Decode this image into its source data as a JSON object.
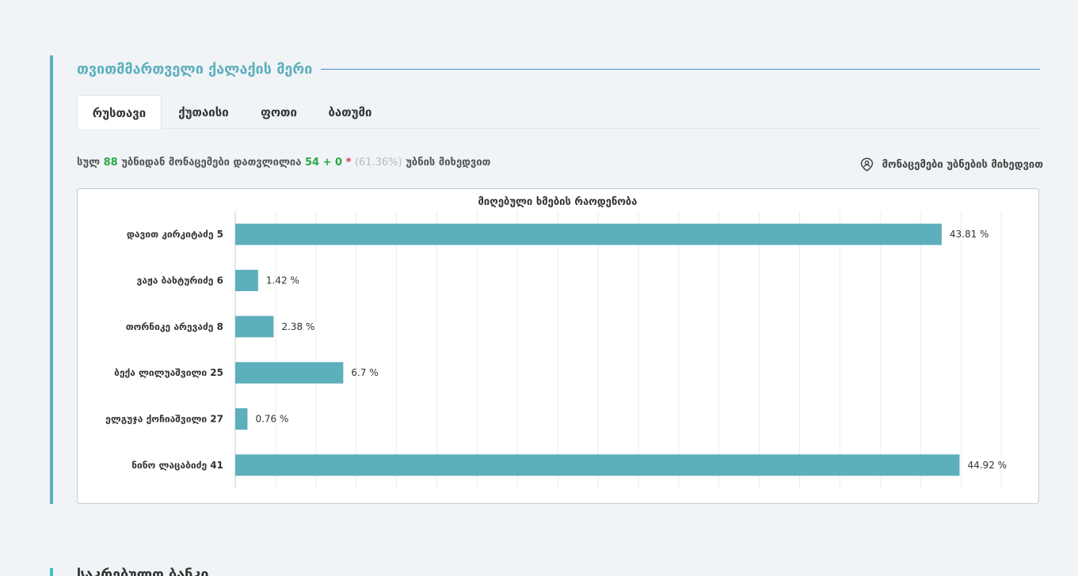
{
  "section": {
    "title": "თვითმმართველი ქალაქის მერი"
  },
  "tabs": [
    {
      "label": "რუსთავი",
      "active": true
    },
    {
      "label": "ქუთაისი",
      "active": false
    },
    {
      "label": "ფოთი",
      "active": false
    },
    {
      "label": "ბათუმი",
      "active": false
    }
  ],
  "stats": {
    "prefix": "სულ",
    "total_precincts": "88",
    "middle": "უბნიდან მონაცემები დათვლილია",
    "counted": "54 + 0",
    "star": "*",
    "percent": "(61.36%)",
    "suffix": "უბნის მიხედვით"
  },
  "by_precinct": {
    "label": "მონაცემები უბნების მიხედვით",
    "icon": "person-pin-icon"
  },
  "colors": {
    "accent": "#5eafbc",
    "bar": "#5eafbc",
    "green": "#28a745",
    "red": "#dc3545"
  },
  "chart_data": {
    "type": "bar",
    "orientation": "horizontal",
    "title": "მიღებული ხმების რაოდენობა",
    "categories": [
      "დავით კირკიტაძე 5",
      "ვაჟა ბახტურიძე 6",
      "თორნიკე არევაძე 8",
      "ბექა ლილუაშვილი 25",
      "ელგუჯა ქოჩიაშვილი 27",
      "ნინო ლაცაბიძე 41"
    ],
    "values": [
      43.81,
      1.42,
      2.38,
      6.7,
      0.76,
      44.92
    ],
    "value_suffix": " %",
    "xlim": [
      0,
      47.5
    ],
    "grid": true
  },
  "next_section": {
    "title": "საკრებულო ბანკი"
  }
}
